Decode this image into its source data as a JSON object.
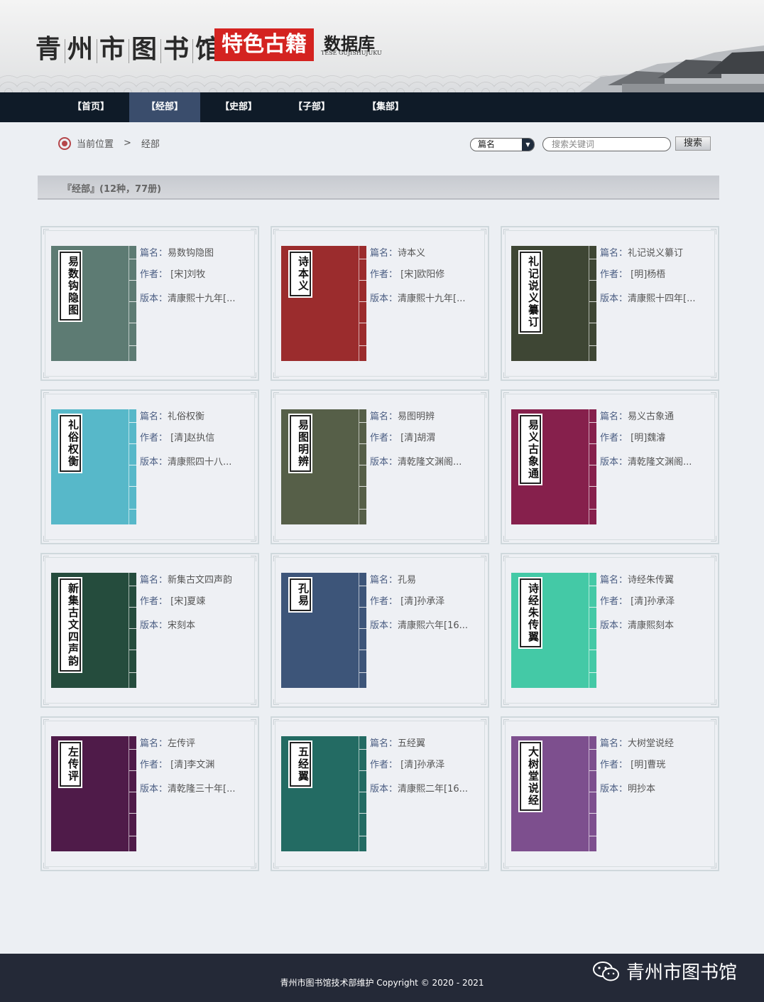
{
  "header": {
    "site_title": [
      "青",
      "州",
      "市",
      "图",
      "书",
      "馆"
    ],
    "special": "特色古籍",
    "db_title": "数据库",
    "db_sub": "TESE GUJISHUJUKU"
  },
  "nav": [
    {
      "label": "【首页】",
      "active": false
    },
    {
      "label": "【经部】",
      "active": true
    },
    {
      "label": "【史部】",
      "active": false
    },
    {
      "label": "【子部】",
      "active": false
    },
    {
      "label": "【集部】",
      "active": false
    }
  ],
  "breadcrumb": {
    "prefix": "当前位置",
    "sep": ">",
    "current": "经部"
  },
  "search": {
    "field_selected": "篇名",
    "placeholder": "搜索关键词",
    "button": "搜索"
  },
  "section_title": "『经部』(12种，77册)",
  "field_labels": {
    "title": "篇名：",
    "author": "作者：",
    "edition": "版本："
  },
  "books": [
    {
      "cover_title": "易数钩隐图",
      "title": "易数钩隐图",
      "author": " [宋]刘牧",
      "edition": "清康熙十九年[...",
      "color": "#5d7b73"
    },
    {
      "cover_title": "诗本义",
      "title": "诗本义",
      "author": " [宋]欧阳修",
      "edition": "清康熙十九年[...",
      "color": "#9b2c2d"
    },
    {
      "cover_title": "礼记说义纂订",
      "title": "礼记说义纂订",
      "author": " [明]杨梧",
      "edition": "清康熙十四年[...",
      "color": "#3e4634"
    },
    {
      "cover_title": "礼俗权衡",
      "title": "礼俗权衡",
      "author": " [清]赵执信",
      "edition": "清康熙四十八...",
      "color": "#57b8c9"
    },
    {
      "cover_title": "易图明辨",
      "title": "易图明辨",
      "author": " [清]胡渭",
      "edition": "清乾隆文渊阁...",
      "color": "#565f48"
    },
    {
      "cover_title": "易义古象通",
      "title": "易义古象通",
      "author": " [明]魏濬",
      "edition": "清乾隆文渊阁...",
      "color": "#86204c"
    },
    {
      "cover_title": "新集古文四声韵",
      "title": "新集古文四声韵",
      "author": " [宋]夏竦",
      "edition": "宋刻本",
      "color": "#254c3d"
    },
    {
      "cover_title": "孔易",
      "title": "孔易",
      "author": " [清]孙承泽",
      "edition": "清康熙六年[16...",
      "color": "#3d5579"
    },
    {
      "cover_title": "诗经朱传翼",
      "title": "诗经朱传翼",
      "author": " [清]孙承泽",
      "edition": "清康熙刻本",
      "color": "#44c9a6"
    },
    {
      "cover_title": "左传评",
      "title": "左传评",
      "author": " [清]李文渊",
      "edition": "清乾隆三十年[...",
      "color": "#4f1b49"
    },
    {
      "cover_title": "五经翼",
      "title": "五经翼",
      "author": " [清]孙承泽",
      "edition": "清康熙二年[16...",
      "color": "#236b63"
    },
    {
      "cover_title": "大树堂说经",
      "title": "大树堂说经",
      "author": " [明]曹珖",
      "edition": "明抄本",
      "color": "#7d4f8e"
    }
  ],
  "footer": {
    "text": "青州市图书馆技术部维护 Copyright © 2020 - 2021",
    "wechat_name": "青州市图书馆"
  }
}
